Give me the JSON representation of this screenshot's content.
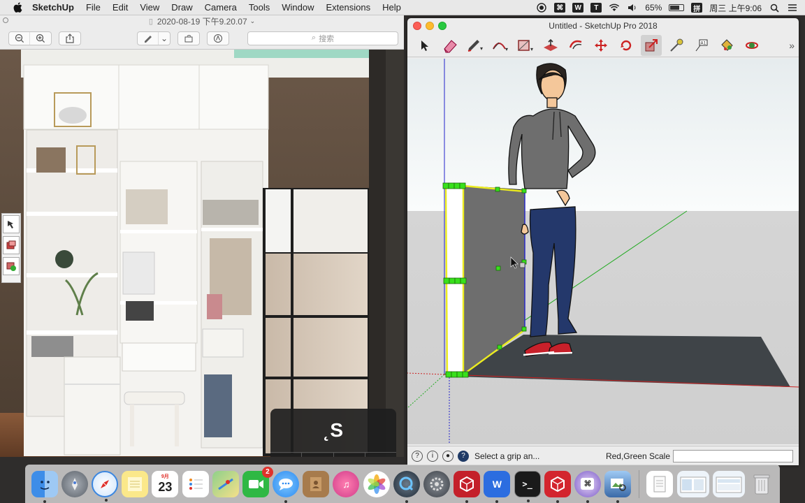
{
  "menubar": {
    "app_name": "SketchUp",
    "items": [
      "File",
      "Edit",
      "View",
      "Draw",
      "Camera",
      "Tools",
      "Window",
      "Extensions",
      "Help"
    ],
    "battery": "65%",
    "clock": "周三 上午9:06",
    "input_method": "拼"
  },
  "preview": {
    "title": "2020-08-19 下午9.20.07",
    "search_placeholder": "搜索"
  },
  "keycast": {
    "key": "˛S",
    "modifiers": [
      "⇧",
      "^",
      "⌥",
      "⌘"
    ]
  },
  "sketchup": {
    "title": "Untitled - SketchUp Pro 2018",
    "tools": [
      "select-tool",
      "eraser-tool",
      "pencil-tool",
      "arc-tool",
      "rectangle-tool",
      "push-pull-tool",
      "offset-tool",
      "move-tool",
      "rotate-tool",
      "scale-tool",
      "tape-measure-tool",
      "text-tool",
      "paint-bucket-tool",
      "orbit-tool"
    ],
    "active_tool": "scale-tool",
    "status_message": "Select a grip an...",
    "vcb_label": "Red,Green Scale",
    "vcb_value": ""
  },
  "dock": {
    "apps": [
      "finder",
      "launchpad",
      "safari",
      "notes",
      "calendar",
      "reminders",
      "maps",
      "facetime",
      "messages",
      "contacts",
      "music",
      "photos",
      "quicktime",
      "system-preferences",
      "sketchup",
      "wps",
      "terminal",
      "sketchup-2",
      "keystroke",
      "preview"
    ],
    "calendar_date": "23",
    "calendar_month": "9月",
    "facetime_badge": "2"
  }
}
